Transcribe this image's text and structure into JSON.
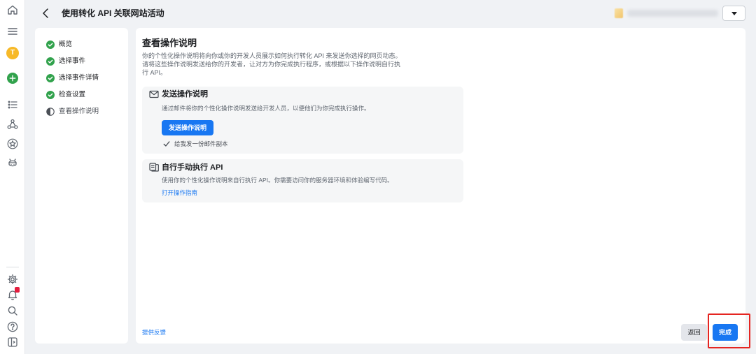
{
  "rail": {
    "top_icons": [
      "home-icon",
      "menu-icon"
    ],
    "avatar_initial": "T",
    "middle_icons": [
      "plus-circle-icon",
      "list-icon",
      "network-icon",
      "star-circle-icon",
      "bug-icon"
    ],
    "bottom_icons": [
      "gear-icon",
      "bell-icon",
      "search-icon",
      "help-icon",
      "panel-toggle-icon"
    ]
  },
  "header": {
    "back_icon": "chevron-left-icon",
    "title": "使用转化 API 关联网站活动",
    "account_selector_icon": "caret-down-icon"
  },
  "steps": [
    {
      "label": "概览",
      "icon": "check-circle-icon"
    },
    {
      "label": "选择事件",
      "icon": "check-circle-icon"
    },
    {
      "label": "选择事件详情",
      "icon": "check-circle-icon"
    },
    {
      "label": "检查设置",
      "icon": "check-circle-icon"
    },
    {
      "label": "查看操作说明",
      "icon": "half-circle-icon"
    }
  ],
  "main": {
    "title": "查看操作说明",
    "description": "你的个性化操作说明将向你或你的开发人员展示如何执行转化 API 来发送你选择的网页动态。请将这些操作说明发送给你的开发者，让对方为你完成执行程序，或根据以下操作说明自行执行 API。",
    "send_instructions": {
      "icon": "envelope-icon",
      "title": "发送操作说明",
      "description": "通过邮件将你的个性化操作说明发送给开发人员，以便他们为你完成执行操作。",
      "button": "发送操作说明",
      "checkbox_label": "给我发一份邮件副本",
      "checkbox_checked": true
    },
    "manual_setup": {
      "icon": "document-icon",
      "title": "自行手动执行 API",
      "description": "使用你的个性化操作说明来自行执行 API。你需要访问你的服务器环境和体验编写代码。",
      "link": "打开操作指南"
    },
    "feedback_link": "提供反馈",
    "back_button": "返回",
    "done_button": "完成"
  },
  "colors": {
    "accent": "#1877f2",
    "success": "#31a24c",
    "highlight": "#e52521",
    "badge": "#e41e3f",
    "avatar": "#f7b928",
    "page_bg": "#f0f2f5"
  }
}
